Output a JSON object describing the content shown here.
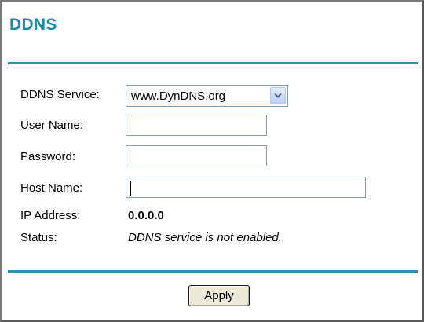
{
  "page": {
    "title": "DDNS"
  },
  "form": {
    "service": {
      "label": "DDNS Service:",
      "value": "www.DynDNS.org"
    },
    "username": {
      "label": "User Name:",
      "value": ""
    },
    "password": {
      "label": "Password:",
      "value": ""
    },
    "hostname": {
      "label": "Host Name:",
      "value": ""
    },
    "ip": {
      "label": "IP Address:",
      "value": "0.0.0.0"
    },
    "status": {
      "label": "Status:",
      "value": "DDNS service is not enabled."
    }
  },
  "actions": {
    "apply_label": "Apply"
  },
  "colors": {
    "accent": "#2a93b2",
    "title": "#1a8aa8"
  },
  "icons": {
    "dropdown": "chevron-down-icon"
  }
}
